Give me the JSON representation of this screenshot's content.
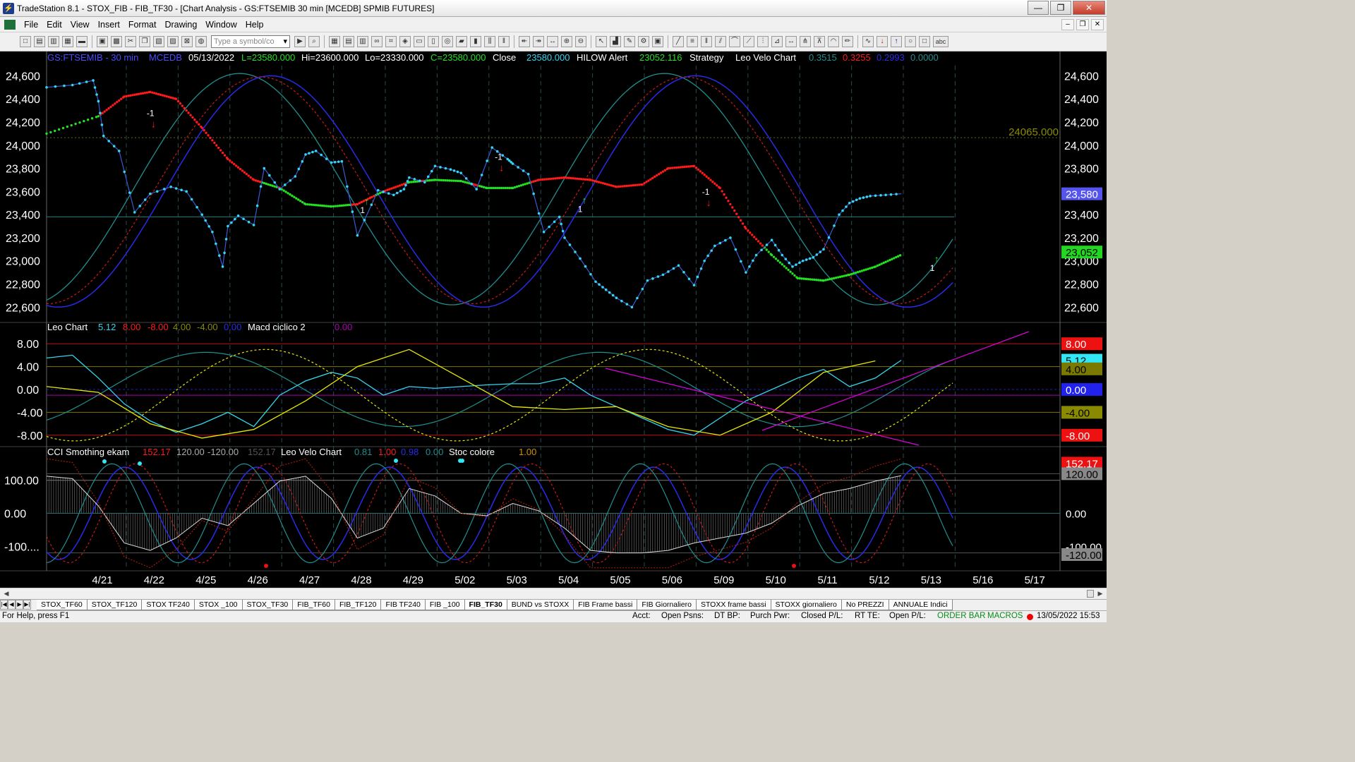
{
  "window": {
    "title": "TradeStation 8.1 - STOX_FIB - FIB_TF30 - [Chart Analysis - GS:FTSEMIB  30 min  [MCEDB] SPMIB FUTURES]",
    "buttons": [
      "—",
      "❐",
      "✕"
    ]
  },
  "menu": {
    "items": [
      "File",
      "Edit",
      "View",
      "Insert",
      "Format",
      "Drawing",
      "Window",
      "Help"
    ],
    "mdi_buttons": [
      "–",
      "❐",
      "✕"
    ]
  },
  "toolbar": {
    "symbol_placeholder": "Type a symbol/co",
    "text_tool": "abc"
  },
  "chart_header": {
    "symbol": "GS:FTSEMIB - 30 min",
    "feed": "MCEDB",
    "date": "05/13/2022",
    "last": "L=23580.000",
    "high": "Hi=23600.000",
    "low": "Lo=23330.000",
    "close": "C=23580.000",
    "close_label": "Close",
    "close_value": "23580.000",
    "hilow": "HILOW Alert",
    "hilow_value": "23052.116",
    "strategy": "Strategy",
    "leo_velo": "Leo Velo Chart",
    "v1": "0.3515",
    "v2": "0.3255",
    "v3": "0.2993",
    "v4": "0.0000"
  },
  "colors": {
    "price": "#33d6f0",
    "red_dots": "#ff1a1a",
    "green_dots": "#22e022",
    "blue_line": "#2a2ae8",
    "darkred_dotted": "#d01818",
    "teal_line": "#1f8f8f",
    "yellow": "#e8e800",
    "magenta": "#e000e0",
    "olive": "#8a8a00"
  },
  "price_panel": {
    "y_ticks": [
      "24,600",
      "24,400",
      "24,200",
      "24,000",
      "23,800",
      "23,600",
      "23,400",
      "23,200",
      "23,000",
      "22,800",
      "22,600"
    ],
    "level_label": "24065.000",
    "last_badge": "23,580",
    "hilow_badge": "23,052",
    "signals": [
      "-1",
      "1",
      "-1",
      "1",
      "-1",
      "1"
    ]
  },
  "leo_panel": {
    "title": "Leo Chart",
    "v1": "5.12",
    "v2": "8.00",
    "v3": "-8.00",
    "v4": "4.00",
    "v5": "-4.00",
    "v6": "0.00",
    "macd_label": "Macd ciclico 2",
    "macd_value": "0.00",
    "y_ticks": [
      "8.00",
      "4.00",
      "0.00",
      "-4.00",
      "-8.00"
    ],
    "badges": [
      "8.00",
      "5.12",
      "4.00",
      "0.00",
      "-4.00",
      "-8.00"
    ]
  },
  "cci_panel": {
    "title": "CCI Smothing ekam",
    "v1": "152.17",
    "v2": "120.00",
    "v3": "-120.00",
    "v4": "152.17",
    "velo_label": "Leo Velo Chart",
    "velo1": "0.81",
    "velo2": "1.00",
    "velo3": "0.98",
    "velo4": "0.00",
    "stoc_label": "Stoc colore",
    "stoc_value": "1.00",
    "y_ticks": [
      "100.00",
      "0.00",
      "-100...."
    ],
    "badges": [
      "152.17",
      "120.00",
      "0.00",
      "-100.00",
      "-120.00"
    ]
  },
  "x_axis": {
    "labels": [
      "4/21",
      "4/22",
      "4/25",
      "4/26",
      "4/27",
      "4/28",
      "4/29",
      "5/02",
      "5/03",
      "5/04",
      "5/05",
      "5/06",
      "5/09",
      "5/10",
      "5/11",
      "5/12",
      "5/13",
      "5/16",
      "5/17"
    ]
  },
  "tabs": [
    "STOX_TF60",
    "STOX_TF120",
    "STOX TF240",
    "STOX _100",
    "STOX_TF30",
    "FIB_TF60",
    "FIB_TF120",
    "FIB TF240",
    "FIB _100",
    "FIB_TF30",
    "BUND vs STOXX",
    "FIB Frame bassi",
    "FIB Giornaliero",
    "STOXX frame bassi",
    "STOXX giornaliero",
    "No PREZZI",
    "ANNUALE Indici"
  ],
  "active_tab": "FIB_TF30",
  "status": {
    "help": "For Help, press F1",
    "acct": "Acct:",
    "open_psns": "Open Psns:",
    "dt_bp": "DT BP:",
    "purch_pwr": "Purch Pwr:",
    "closed_pl": "Closed P/L:",
    "rt_te": "RT TE:",
    "open_pl": "Open P/L:",
    "order_bar": "ORDER BAR",
    "macros": "MACROS",
    "datetime": "13/05/2022 15:53"
  },
  "chart_data": {
    "type": "line",
    "x_labels": [
      "4/21",
      "4/22",
      "4/25",
      "4/26",
      "4/27",
      "4/28",
      "4/29",
      "5/02",
      "5/03",
      "5/04",
      "5/05",
      "5/06",
      "5/09",
      "5/10",
      "5/11",
      "5/12",
      "5/13"
    ],
    "price_ylim": [
      22480,
      24700
    ],
    "price_series": {
      "name": "GS:FTSEMIB - 30 min",
      "x": [
        0,
        0.5,
        0.9,
        1.0,
        1.1,
        1.4,
        1.7,
        2.0,
        2.4,
        2.7,
        3.0,
        3.2,
        3.4,
        3.5,
        3.7,
        4.0,
        4.2,
        4.5,
        4.8,
        5.0,
        5.2,
        5.5,
        5.7,
        6.0,
        6.4,
        6.7,
        6.9,
        7.0,
        7.3,
        7.5,
        7.8,
        8.0,
        8.3,
        8.6,
        8.9,
        9.0,
        9.3,
        9.6,
        9.9,
        10.0,
        10.3,
        10.6,
        10.8,
        11.0,
        11.3,
        11.6,
        11.9,
        12.2,
        12.5,
        12.7,
        12.9,
        13.2,
        13.5,
        13.7,
        14.0,
        14.2,
        14.4,
        14.6,
        14.8,
        15.0,
        15.3,
        15.5,
        15.7,
        15.9,
        16.2,
        16.5
      ],
      "y": [
        24500,
        24520,
        24560,
        24380,
        24080,
        23950,
        23420,
        23580,
        23640,
        23600,
        23400,
        23250,
        22950,
        23300,
        23390,
        23310,
        23800,
        23620,
        23730,
        23920,
        23950,
        23850,
        23860,
        23220,
        23610,
        23570,
        23620,
        23720,
        23680,
        23820,
        23790,
        23760,
        23620,
        23980,
        23880,
        23840,
        23750,
        23250,
        23380,
        23200,
        23020,
        22820,
        22750,
        22680,
        22600,
        22830,
        22880,
        22960,
        22790,
        23000,
        23130,
        23200,
        22900,
        23050,
        23180,
        23050,
        22950,
        23000,
        23030,
        23100,
        23400,
        23500,
        23540,
        23560,
        23570,
        23580
      ]
    },
    "hilow_series": {
      "name": "HILOW Alert",
      "x": [
        0,
        1.0,
        1.5,
        2.0,
        2.5,
        3.0,
        3.5,
        4.0,
        4.5,
        5.0,
        5.5,
        6.0,
        6.5,
        7.0,
        7.5,
        8.0,
        8.5,
        9.0,
        9.5,
        10.0,
        10.5,
        11.0,
        11.5,
        12.0,
        12.5,
        13.0,
        13.5,
        14.0,
        14.5,
        15.0,
        15.5,
        16.0,
        16.5
      ],
      "y": [
        24100,
        24250,
        24420,
        24460,
        24400,
        24150,
        23880,
        23700,
        23630,
        23490,
        23470,
        23490,
        23600,
        23680,
        23700,
        23690,
        23630,
        23630,
        23700,
        23720,
        23700,
        23640,
        23660,
        23800,
        23820,
        23630,
        23280,
        23050,
        22850,
        22830,
        22880,
        22950,
        23052
      ]
    },
    "level_line": 24065,
    "hline": 23380,
    "leo_ylim": [
      -10,
      10
    ],
    "leo_series": {
      "name": "Leo Chart",
      "x": [
        0,
        0.5,
        1.0,
        1.5,
        2.0,
        2.5,
        3.0,
        3.5,
        4.0,
        4.5,
        5.0,
        5.5,
        6.0,
        6.5,
        7.0,
        7.5,
        8.0,
        8.5,
        9.0,
        9.5,
        10.0,
        10.5,
        11.0,
        11.5,
        12.0,
        12.5,
        13.0,
        13.5,
        14.0,
        14.5,
        15.0,
        15.5,
        16.0,
        16.5
      ],
      "y": [
        5.5,
        6.0,
        2.0,
        -2.5,
        -5.5,
        -7.5,
        -6.0,
        -4.0,
        -6.5,
        -1.0,
        1.5,
        3.0,
        2.0,
        -1.0,
        0.5,
        0.2,
        0.5,
        0.8,
        1.0,
        1.0,
        2.0,
        -1.0,
        -3.0,
        -5.0,
        -7.0,
        -8.0,
        -5.0,
        -2.0,
        0.0,
        2.0,
        3.5,
        0.5,
        2.0,
        5.12
      ]
    },
    "macd_series": {
      "name": "Macd ciclico 2",
      "x": [
        0,
        1.0,
        2.0,
        3.0,
        4.0,
        5.0,
        6.0,
        7.0,
        8.0,
        9.0,
        10.0,
        11.0,
        12.0,
        13.0,
        14.0,
        15.0,
        16.0
      ],
      "y": [
        0.5,
        -0.5,
        -6.0,
        -8.5,
        -7.0,
        -2.0,
        4.0,
        7.0,
        2.0,
        -3.0,
        -3.5,
        -3.0,
        -6.5,
        -8.0,
        -4.0,
        3.0,
        5.0
      ]
    },
    "cci_ylim": [
      -170,
      170
    ],
    "cci_series": {
      "name": "CCI Smothing ekam",
      "x": [
        0,
        0.5,
        1.0,
        1.5,
        2.0,
        2.5,
        3.0,
        3.5,
        4.0,
        4.5,
        5.0,
        5.5,
        6.0,
        6.5,
        7.0,
        7.5,
        8.0,
        8.5,
        9.0,
        9.5,
        10.0,
        10.5,
        11.0,
        11.5,
        12.0,
        12.5,
        13.0,
        13.5,
        14.0,
        14.5,
        15.0,
        15.5,
        16.0,
        16.5
      ],
      "y": [
        150,
        140,
        30,
        -120,
        -150,
        -100,
        -20,
        -50,
        40,
        130,
        150,
        60,
        -100,
        -60,
        100,
        70,
        0,
        -10,
        40,
        10,
        -60,
        -150,
        -160,
        -160,
        -150,
        -120,
        -100,
        -80,
        -40,
        30,
        80,
        100,
        130,
        152.17
      ]
    }
  }
}
